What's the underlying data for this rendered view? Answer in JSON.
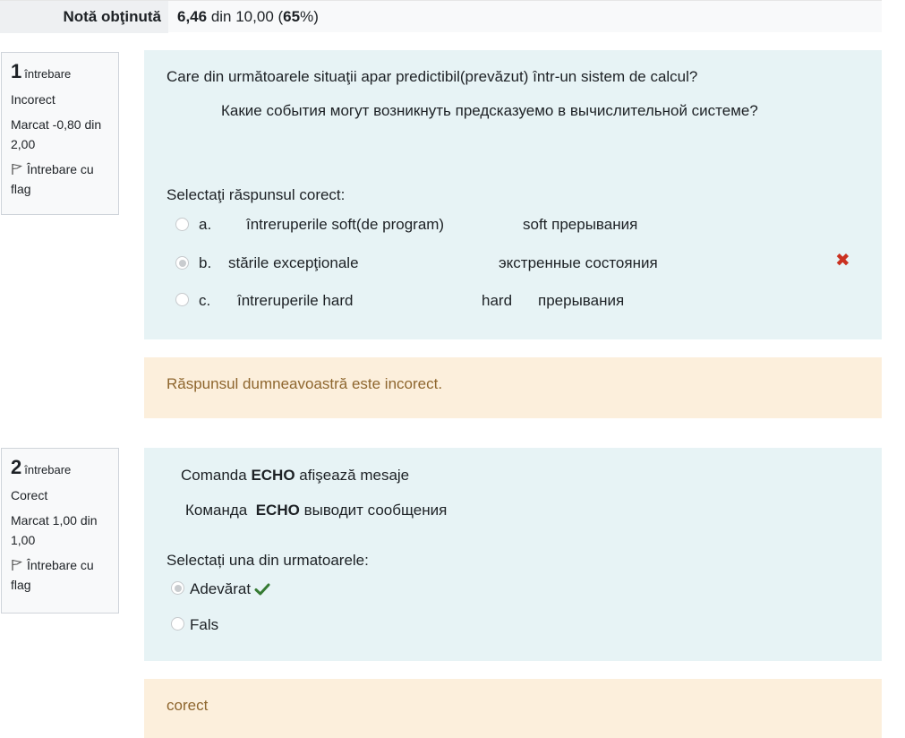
{
  "grade": {
    "label": "Notă obţinută",
    "score": "6,46",
    "mid": " din 10,00 (",
    "percent": "65",
    "end": "%)"
  },
  "questions": [
    {
      "number": "1",
      "word": "întrebare",
      "status": "Incorect",
      "mark": "Marcat -0,80 din 2,00",
      "flag": "Întrebare cu flag",
      "text_ro": "Care din următoarele situaţii apar predictibil(prevăzut) într-un sistem de calcul?",
      "text_ru": "Какие события могут возникнуть предсказуемо в вычислительной системе?",
      "prompt": "Selectaţi răspunsul corect:",
      "options": [
        {
          "letter": "a.",
          "ro": "întreruperile soft(de program)",
          "ru": "soft прерывания"
        },
        {
          "letter": "b.",
          "ro": "stările excepţionale",
          "ru": "экстренные состояния"
        },
        {
          "letter": "c.",
          "ro": "întreruperile hard",
          "ru1": "hard",
          "ru2": "прерывания"
        }
      ],
      "wrong_icon": "✖",
      "feedback": "Răspunsul dumneavoastră este incorect."
    },
    {
      "number": "2",
      "word": "întrebare",
      "status": "Corect",
      "mark": "Marcat 1,00 din 1,00",
      "flag": "Întrebare cu flag",
      "line1_pre": "Comanda ",
      "line1_bold": "ECHO",
      "line1_post": " afişează mesaje",
      "line2_pre": "Команда  ",
      "line2_bold": "ECHO",
      "line2_post": " выводит сообщения",
      "prompt": "Selectați una din urmatoarele:",
      "options": [
        {
          "label": "Adevărat"
        },
        {
          "label": "Fals"
        }
      ],
      "feedback": "corect"
    }
  ]
}
